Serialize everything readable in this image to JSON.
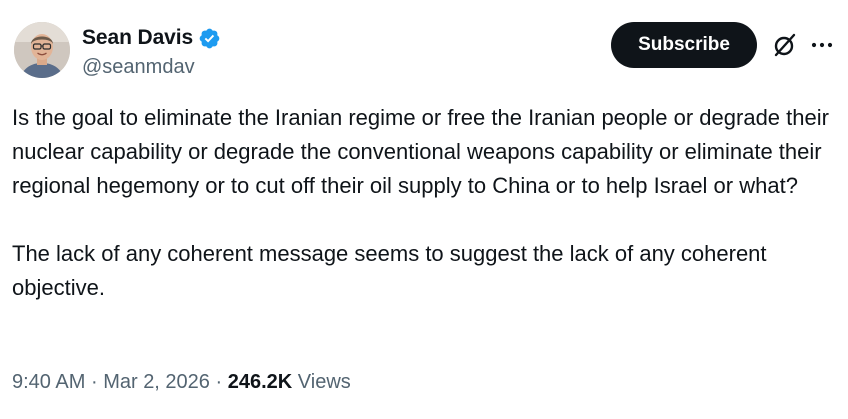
{
  "author": {
    "display_name": "Sean Davis",
    "handle": "@seanmdav",
    "verified": true,
    "verified_color": "#1d9bf0"
  },
  "actions": {
    "subscribe_label": "Subscribe",
    "grok_icon": "slashed-circle-icon",
    "more_icon": "more-horizontal-icon"
  },
  "tweet": {
    "paragraphs": [
      "Is the goal to eliminate the Iranian regime or free the Iranian people or degrade their nuclear capability or degrade the conventional weapons capability or eliminate their regional hegemony or to cut off their oil supply to China or to help Israel or what?",
      "The lack of any coherent message seems to suggest the lack of any coherent objective."
    ]
  },
  "meta": {
    "time": "9:40 AM",
    "separator": "·",
    "date": "Mar 2, 2026",
    "views_count": "246.2K",
    "views_label": "Views"
  },
  "colors": {
    "text_primary": "#0f1419",
    "text_secondary": "#536471",
    "button_bg": "#0f1419"
  }
}
